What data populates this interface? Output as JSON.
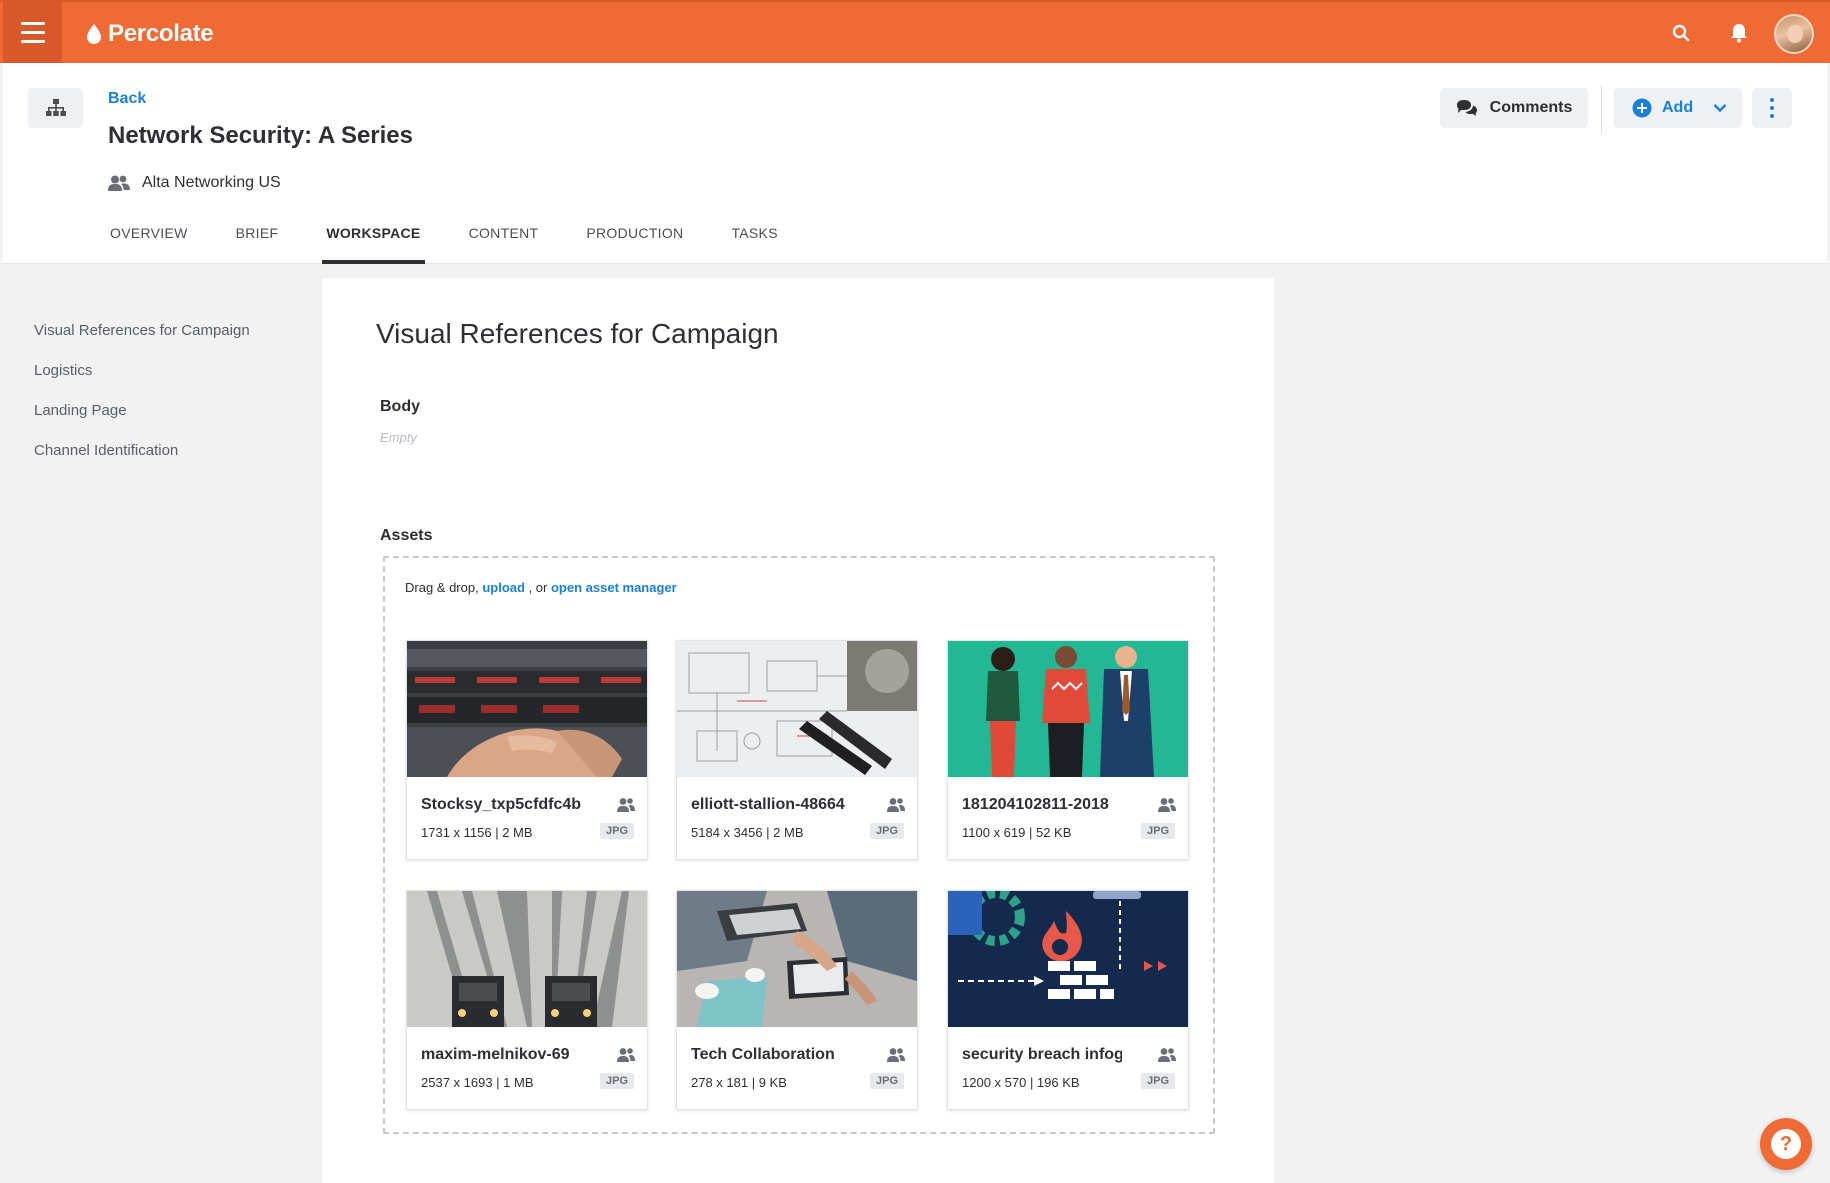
{
  "app": {
    "name": "Percolate"
  },
  "header": {
    "back_label": "Back",
    "title": "Network Security: A Series",
    "team": "Alta Networking US",
    "comments_label": "Comments",
    "add_label": "Add"
  },
  "tabs": [
    {
      "label": "OVERVIEW",
      "active": false
    },
    {
      "label": "BRIEF",
      "active": false
    },
    {
      "label": "WORKSPACE",
      "active": true
    },
    {
      "label": "CONTENT",
      "active": false
    },
    {
      "label": "PRODUCTION",
      "active": false
    },
    {
      "label": "TASKS",
      "active": false
    }
  ],
  "sidebar": {
    "items": [
      {
        "label": "Visual References for Campaign"
      },
      {
        "label": "Logistics"
      },
      {
        "label": "Landing Page"
      },
      {
        "label": "Channel Identification"
      }
    ]
  },
  "main": {
    "section_title": "Visual References for Campaign",
    "body_label": "Body",
    "body_value": "Empty",
    "assets_label": "Assets",
    "dropzone": {
      "prefix": "Drag & drop,",
      "upload_label": "upload",
      "middle": ", or",
      "manager_label": "open asset manager"
    },
    "assets": [
      {
        "name": "Stocksy_txp5cfdfc4b",
        "meta": "1731 x 1156 | 2 MB",
        "type": "JPG",
        "icon": "server-photo"
      },
      {
        "name": "elliott-stallion-48664",
        "meta": "5184 x 3456 | 2 MB",
        "type": "JPG",
        "icon": "blueprint-photo"
      },
      {
        "name": "181204102811-2018",
        "meta": "1100 x 619 | 52 KB",
        "type": "JPG",
        "icon": "people-illustration"
      },
      {
        "name": "maxim-melnikov-69",
        "meta": "2537 x 1693 | 1 MB",
        "type": "JPG",
        "icon": "trains-photo"
      },
      {
        "name": "Tech Collaboration",
        "meta": "278 x 181 | 9 KB",
        "type": "JPG",
        "icon": "meeting-photo"
      },
      {
        "name": "security breach infog",
        "meta": "1200 x 570 | 196 KB",
        "type": "JPG",
        "icon": "firewall-illustration"
      }
    ]
  },
  "colors": {
    "brand": "#f06a35",
    "link": "#1a7fd8",
    "text": "#2d2f33"
  },
  "help": {
    "label": "?"
  }
}
